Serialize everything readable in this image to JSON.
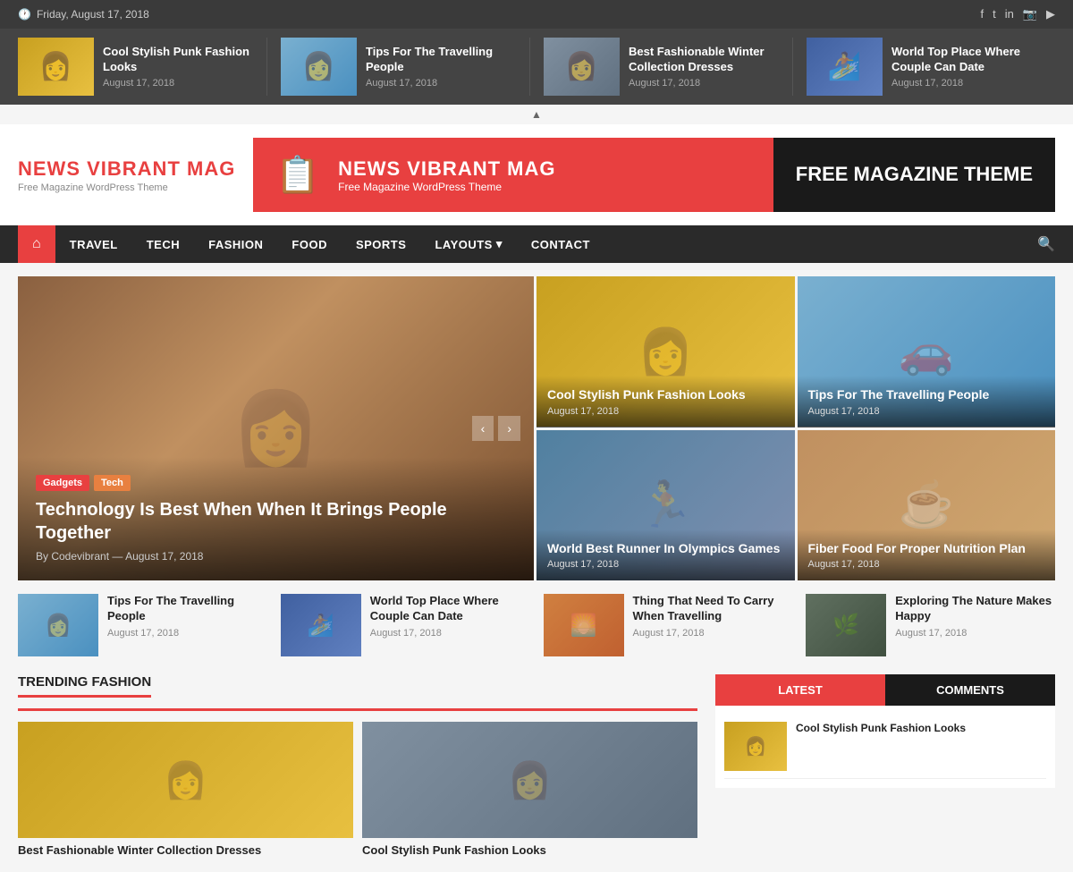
{
  "topbar": {
    "date": "Friday, August 17, 2018",
    "social": [
      "f",
      "t",
      "in",
      "ig",
      "yt"
    ]
  },
  "featured_strip": [
    {
      "title": "Cool Stylish Punk Fashion Looks",
      "date": "August 17, 2018",
      "img_class": "img-yellow"
    },
    {
      "title": "Tips For The Travelling People",
      "date": "August 17, 2018",
      "img_class": "img-travel"
    },
    {
      "title": "Best Fashionable Winter Collection Dresses",
      "date": "August 17, 2018",
      "img_class": "img-winter"
    },
    {
      "title": "World Top Place Where Couple Can Date",
      "date": "August 17, 2018",
      "img_class": "img-blue"
    }
  ],
  "header": {
    "logo_main": "NEWS VIBRANT",
    "logo_accent": "MAG",
    "logo_sub": "Free Magazine WordPress Theme",
    "banner_title": "NEWS VIBRANT MAG",
    "banner_sub": "Free Magazine WordPress Theme",
    "banner_right": "FREE MAGAZINE THEME"
  },
  "nav": {
    "home_icon": "⌂",
    "items": [
      "TRAVEL",
      "TECH",
      "FASHION",
      "FOOD",
      "SPORTS",
      "LAYOUTS",
      "CONTACT"
    ],
    "layouts_has_dropdown": true
  },
  "hero": {
    "main": {
      "tags": [
        "Gadgets",
        "Tech"
      ],
      "title": "Technology Is Best When When It Brings People Together",
      "author": "Codevibrant",
      "date": "August 17, 2018"
    },
    "side_top": {
      "title": "Cool Stylish Punk Fashion Looks",
      "date": "August 17, 2018"
    },
    "side_top_right": {
      "title": "Tips For The Travelling People",
      "date": "August 17, 2018"
    },
    "side_bottom": {
      "title": "World Best Runner In Olympics Games",
      "date": "August 17, 2018"
    },
    "side_bottom_right": {
      "title": "Fiber Food For Proper Nutrition Plan",
      "date": "August 17, 2018"
    }
  },
  "small_cards": [
    {
      "title": "Tips For The Travelling People",
      "date": "August 17, 2018",
      "img_class": "img-travel"
    },
    {
      "title": "World Top Place Where Couple Can Date",
      "date": "August 17, 2018",
      "img_class": "img-blue"
    },
    {
      "title": "Thing That Need To Carry When Travelling",
      "date": "August 17, 2018",
      "img_class": "img-sunset"
    },
    {
      "title": "Exploring The Nature Makes Happy",
      "date": "August 17, 2018",
      "img_class": "img-nature"
    }
  ],
  "trending": {
    "section_title": "TRENDING FASHION",
    "cards": [
      {
        "title": "Best Fashionable Winter Collection Dresses",
        "img_class": "img-yellow"
      },
      {
        "title": "Cool Stylish Punk Fashion Looks",
        "img_class": "img-winter"
      }
    ]
  },
  "sidebar": {
    "tab_latest": "LATEST",
    "tab_comments": "COMMENTS",
    "items": [
      {
        "title": "Cool Stylish Punk Fashion Looks",
        "img_class": "img-yellow"
      }
    ]
  }
}
